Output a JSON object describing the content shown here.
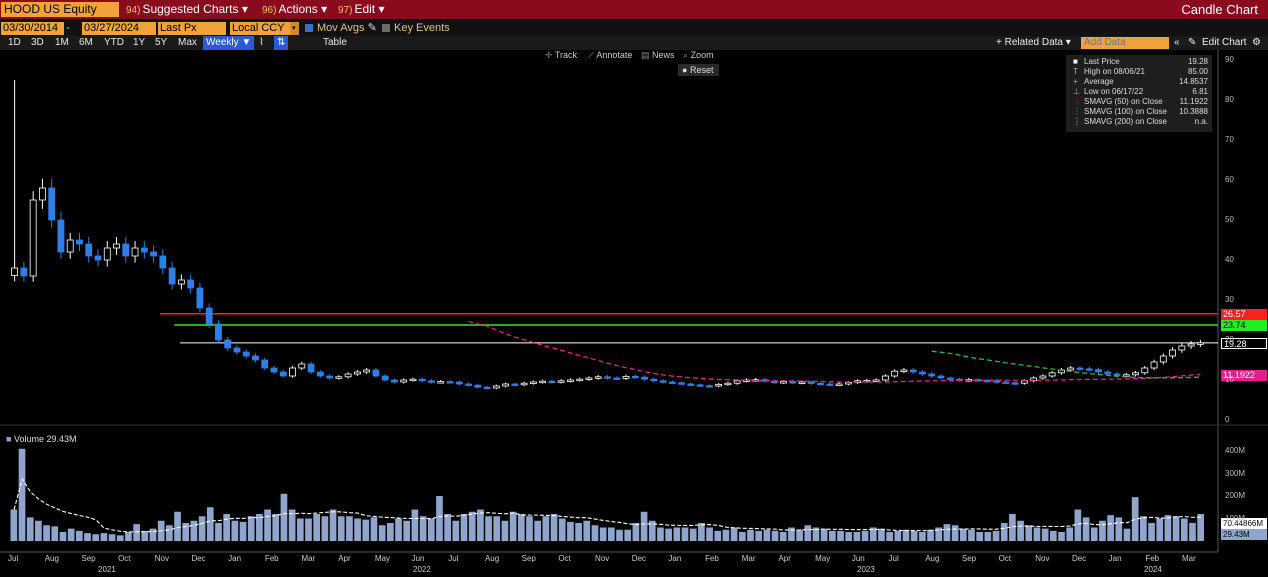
{
  "header": {
    "ticker": "HOOD US Equity",
    "menus": [
      {
        "num": "94)",
        "label": "Suggested Charts ▾"
      },
      {
        "num": "96)",
        "label": "Actions ▾"
      },
      {
        "num": "97)",
        "label": "Edit ▾"
      }
    ],
    "chart_title": "Candle Chart"
  },
  "settings": {
    "start_date": "03/30/2014",
    "end_date": "03/27/2024",
    "field": "Last Px",
    "currency": "Local CCY",
    "mov_avgs": "Mov Avgs",
    "key_events": "Key Events"
  },
  "toolbar": {
    "periods": [
      "1D",
      "3D",
      "1M",
      "6M",
      "YTD",
      "1Y",
      "5Y",
      "Max"
    ],
    "frequency": "Weekly ▼",
    "table": "Table",
    "related_data": "+ Related Data ▾",
    "add_data_placeholder": "Add Data",
    "edit_chart": "Edit Chart"
  },
  "chart_tools": {
    "track": "Track",
    "annotate": "Annotate",
    "news": "News",
    "zoom": "Zoom",
    "reset": "Reset"
  },
  "legend": [
    {
      "label": "Last Price",
      "value": "19.28"
    },
    {
      "label": "High on 08/06/21",
      "value": "85.00"
    },
    {
      "label": "Average",
      "value": "14.8537"
    },
    {
      "label": "Low on 06/17/22",
      "value": "6.81"
    },
    {
      "label": "SMAVG (50)  on Close",
      "value": "11.1922"
    },
    {
      "label": "SMAVG (100)  on Close",
      "value": "10.3888"
    },
    {
      "label": "SMAVG (200)  on Close",
      "value": "n.a."
    }
  ],
  "price_tags": {
    "red_line": "26.57",
    "green_line": "23.74",
    "last_price": "19.28",
    "sma50": "11.1922"
  },
  "volume": {
    "label": "Volume  29.43M",
    "tag_avg": "70.44866M",
    "tag_last": "29.43M"
  },
  "colors": {
    "up": "#ffffff",
    "down": "#2f7fe8",
    "red_line": "#ff2020",
    "green_line": "#22ee22",
    "last_line": "#ffffff",
    "sma50": "#e0208c",
    "sma100": "#2fb54a",
    "volume_bar": "#8fa5cc"
  },
  "chart_data": {
    "type": "candlestick",
    "frequency": "weekly",
    "y_ticks": [
      0,
      10,
      20,
      30,
      40,
      50,
      60,
      70,
      80,
      90
    ],
    "vol_ticks": [
      "400M",
      "300M",
      "200M",
      "100M"
    ],
    "months": [
      "Jul",
      "Aug",
      "Sep",
      "Oct",
      "Nov",
      "Dec",
      "Jan",
      "Feb",
      "Mar",
      "Apr",
      "May",
      "Jun",
      "Jul",
      "Aug",
      "Sep",
      "Oct",
      "Nov",
      "Dec",
      "Jan",
      "Feb",
      "Mar",
      "Apr",
      "May",
      "Jun",
      "Jul",
      "Aug",
      "Sep",
      "Oct",
      "Nov",
      "Dec",
      "Jan",
      "Feb",
      "Mar"
    ],
    "years": [
      "2021",
      "2022",
      "2023",
      "2024"
    ],
    "levels": {
      "red": 26.57,
      "green": 23.74,
      "last": 19.28
    },
    "closes": [
      38,
      36,
      55,
      58,
      50,
      42,
      45,
      44,
      41,
      40,
      43,
      44,
      41,
      43,
      42,
      41,
      38,
      34,
      35,
      33,
      28,
      24,
      20,
      18,
      17,
      16,
      15,
      13,
      12,
      11,
      13,
      14,
      12,
      11,
      10.5,
      10.8,
      11.5,
      12,
      12.5,
      11,
      10,
      9.5,
      10,
      10.2,
      9.8,
      9.5,
      9.6,
      9.5,
      9,
      8.7,
      8.2,
      8,
      8.5,
      9,
      8.8,
      9.2,
      9.5,
      9.7,
      9.5,
      9.8,
      10,
      10.2,
      10.5,
      10.8,
      10.5,
      10.4,
      10.9,
      10.7,
      10.2,
      9.8,
      9.5,
      9.3,
      9,
      8.8,
      8.6,
      8.5,
      8.9,
      9.2,
      9.8,
      10,
      10.1,
      9.7,
      9.4,
      9.6,
      9.3,
      9.5,
      9.2,
      9.0,
      8.9,
      9.0,
      9.4,
      9.8,
      9.9,
      10,
      11,
      12.2,
      12.5,
      12,
      11.5,
      11,
      10.5,
      10.2,
      10,
      10.1,
      9.9,
      9.8,
      9.5,
      9.3,
      9.2,
      9.8,
      10.5,
      11,
      11.8,
      12.5,
      13,
      12.8,
      12.6,
      12,
      11.5,
      11.2,
      11.3,
      11.8,
      13,
      14.5,
      16,
      17.5,
      18.5,
      19,
      19.28
    ],
    "volumes": [
      140,
      410,
      105,
      90,
      70,
      65,
      40,
      55,
      45,
      35,
      30,
      35,
      30,
      25,
      40,
      75,
      45,
      55,
      90,
      70,
      130,
      80,
      90,
      110,
      150,
      80,
      120,
      90,
      85,
      110,
      120,
      140,
      120,
      210,
      140,
      100,
      100,
      120,
      110,
      140,
      110,
      110,
      100,
      95,
      105,
      70,
      80,
      100,
      90,
      140,
      110,
      100,
      200,
      120,
      90,
      120,
      130,
      140,
      110,
      110,
      90,
      130,
      120,
      110,
      90,
      110,
      120,
      100,
      85,
      80,
      90,
      70,
      60,
      60,
      50,
      50,
      80,
      130,
      90,
      60,
      55,
      60,
      60,
      55,
      80,
      60,
      45,
      50,
      60,
      40,
      50,
      45,
      50,
      45,
      40,
      60,
      50,
      70,
      60,
      55,
      45,
      45,
      40,
      40,
      45,
      60,
      55,
      40,
      45,
      50,
      45,
      40,
      50,
      60,
      75,
      70,
      55,
      50,
      40,
      40,
      45,
      80,
      120,
      90,
      70,
      60,
      55,
      45,
      40,
      60,
      140,
      105,
      60,
      90,
      115,
      105,
      55,
      195,
      110,
      80,
      100,
      115,
      110,
      100,
      80,
      120
    ]
  }
}
